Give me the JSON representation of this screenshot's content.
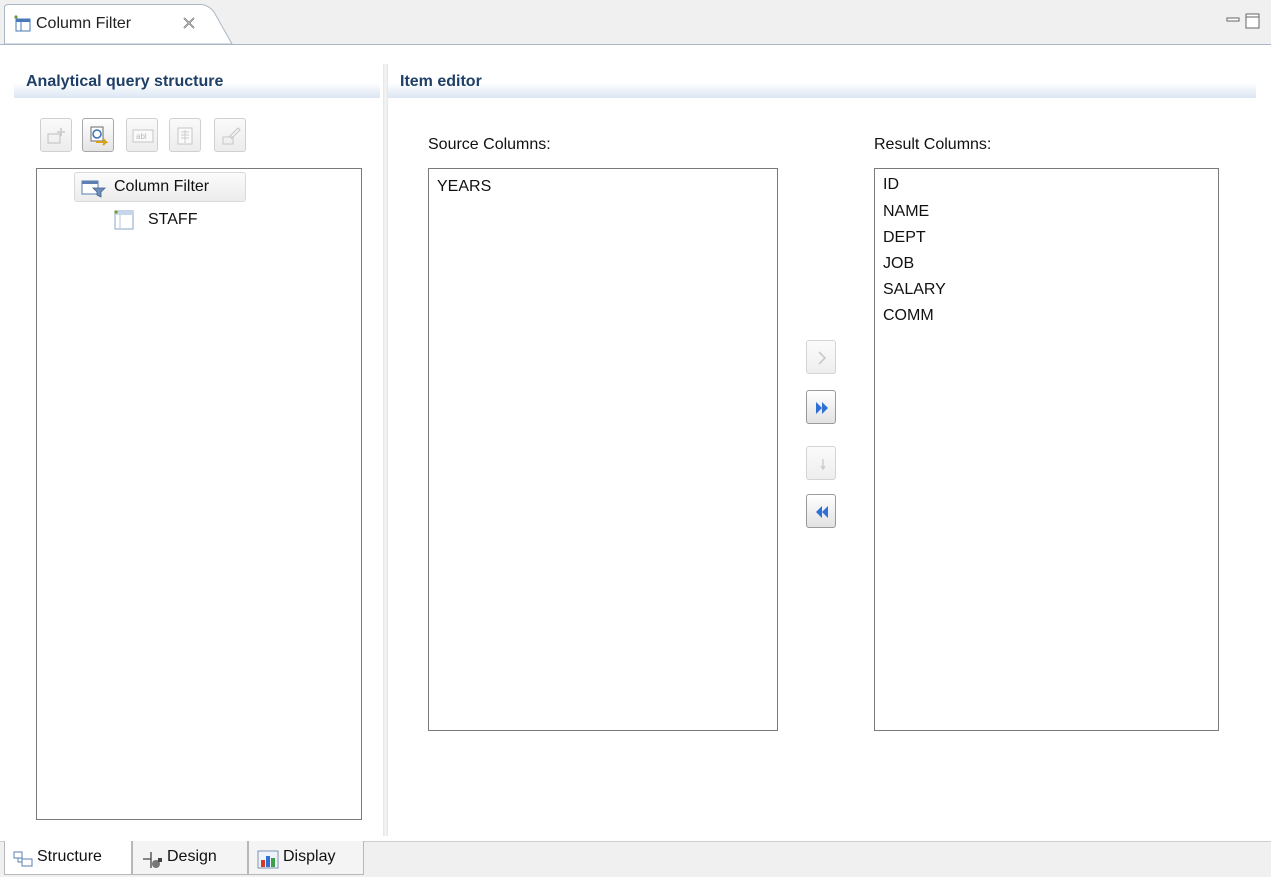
{
  "window": {
    "tab_title": "Column Filter",
    "tab_icon": "column-filter-icon",
    "controls": [
      "minimize-icon",
      "maximize-icon"
    ]
  },
  "left_panel": {
    "title": "Analytical query structure",
    "toolbar": [
      {
        "name": "add-node-icon",
        "enabled": false
      },
      {
        "name": "search-node-icon",
        "enabled": true
      },
      {
        "name": "rename-icon",
        "enabled": false
      },
      {
        "name": "properties-icon",
        "enabled": false
      },
      {
        "name": "edit-icon",
        "enabled": false
      }
    ],
    "tree": {
      "root": {
        "label": "Column Filter",
        "icon": "column-filter-node-icon"
      },
      "child": {
        "label": "STAFF",
        "icon": "table-icon"
      }
    }
  },
  "right_panel": {
    "title": "Item editor",
    "source_label": "Source Columns:",
    "result_label": "Result Columns:",
    "source_columns": [
      "YEARS"
    ],
    "result_columns": [
      "ID",
      "NAME",
      "DEPT",
      "JOB",
      "SALARY",
      "COMM"
    ],
    "buttons": [
      {
        "name": "add-selected-button",
        "enabled": false,
        "icon": "chevron-right-icon"
      },
      {
        "name": "add-all-button",
        "enabled": true,
        "icon": "double-chevron-right-icon"
      },
      {
        "name": "remove-selected-button",
        "enabled": false,
        "icon": "chevron-left-icon"
      },
      {
        "name": "remove-all-button",
        "enabled": true,
        "icon": "double-chevron-left-icon"
      }
    ]
  },
  "bottom_tabs": [
    {
      "label": "Structure",
      "icon": "structure-icon",
      "active": true
    },
    {
      "label": "Design",
      "icon": "design-icon",
      "active": false
    },
    {
      "label": "Display",
      "icon": "display-chart-icon",
      "active": false
    }
  ],
  "colors": {
    "header_text": "#1f3f66",
    "header_gradient_end": "#dbe6f3",
    "arrow_blue": "#2f6fd6",
    "border": "#7a7a7a"
  }
}
